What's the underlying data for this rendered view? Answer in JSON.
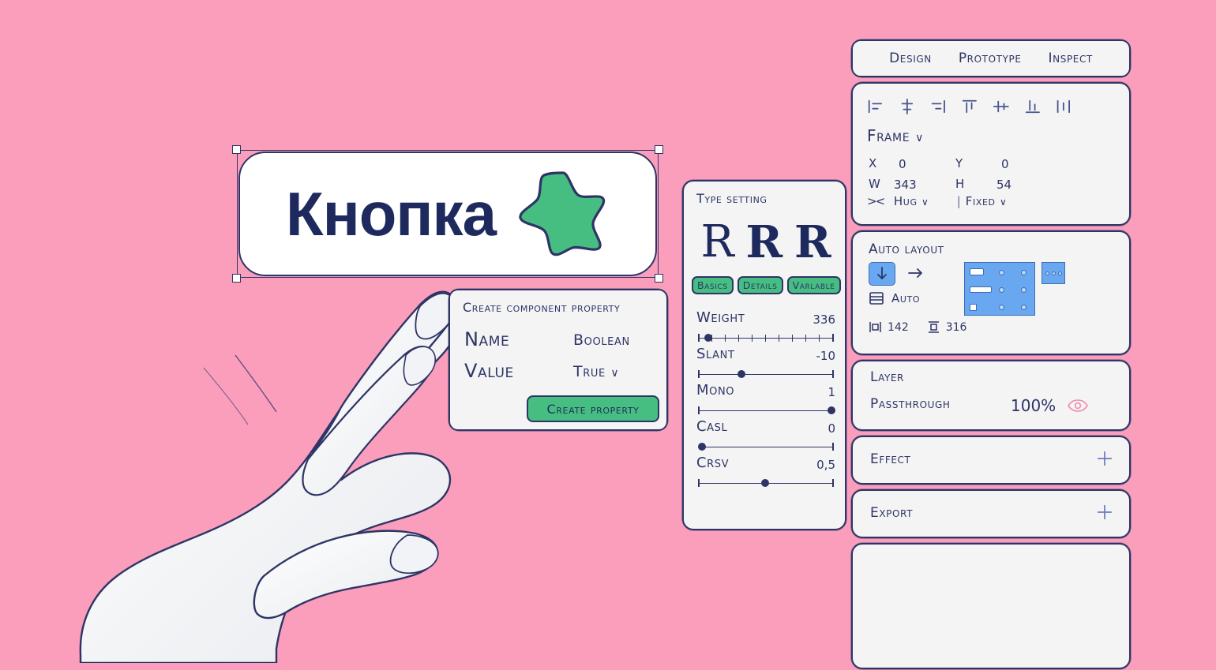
{
  "theme": {
    "background": "#FA9EBC",
    "ink": "#2E3566",
    "panel": "#F4F4F4",
    "green": "#46BE82",
    "blue": "#69A8F0",
    "button_text": "#1E2A5E"
  },
  "canvas": {
    "button_label": "Кнопка",
    "star_icon": "star-icon",
    "selected": true
  },
  "create_property_dialog": {
    "title": "Create component property",
    "rows": [
      {
        "key": "Name",
        "value": "Boolean",
        "has_chevron": false
      },
      {
        "key": "Value",
        "value": "True",
        "has_chevron": true,
        "chevron": "∨"
      }
    ],
    "submit_label": "Create property"
  },
  "type_setting": {
    "title": "Type setting",
    "specimen": [
      "R",
      "R",
      "R"
    ],
    "tabs": [
      "Basics",
      "Details",
      "Varlable"
    ],
    "active_tab": "Basics",
    "sliders": [
      {
        "name": "Weight",
        "value": "336",
        "pos": 8,
        "ticks": true
      },
      {
        "name": "Slant",
        "value": "-10",
        "pos": 30,
        "ticks": false
      },
      {
        "name": "Mono",
        "value": "1",
        "pos": 99,
        "ticks": false
      },
      {
        "name": "Casl",
        "value": "0",
        "pos": 1,
        "ticks": false
      },
      {
        "name": "Crsv",
        "value": "0,5",
        "pos": 48,
        "ticks": false
      }
    ]
  },
  "sidebar": {
    "tabs": [
      "Design",
      "Prototype",
      "Inspect"
    ],
    "active_tab": "Design",
    "properties": {
      "align_icons": [
        "align-left-icon",
        "align-horizontal-center-icon",
        "align-right-icon",
        "align-top-icon",
        "align-vertical-center-icon",
        "align-bottom-icon",
        "distribute-horizontal-icon"
      ],
      "node_type": "Frame",
      "node_type_chevron": "∨",
      "fields": [
        {
          "key": "X",
          "value": "0"
        },
        {
          "key": "Y",
          "value": "0"
        },
        {
          "key": "W",
          "value": "343"
        },
        {
          "key": "H",
          "value": "54"
        }
      ],
      "resize_icon": "resize-horizontal-icon",
      "width_sizing": "Hug",
      "width_chevron": "∨",
      "height_sizing": "Fixed",
      "height_chevron": "∨"
    },
    "auto_layout": {
      "title": "Auto layout",
      "direction_vertical_icon": "arrow-down-icon",
      "direction_horizontal_icon": "arrow-right-icon",
      "spacing_icon": "spacing-icon",
      "spacing_value": "Auto",
      "padding_horizontal_icon": "padding-horizontal-icon",
      "padding_horizontal": "142",
      "padding_vertical_icon": "padding-vertical-icon",
      "padding_vertical": "316",
      "alignment_grid_icon": "alignment-grid-icon",
      "more_options_icon": "more-options-icon"
    },
    "layer": {
      "title": "Layer",
      "blend_mode": "Passthrough",
      "opacity": "100%",
      "visibility_icon": "eye-icon"
    },
    "effect": {
      "title": "Effect",
      "add_icon": "plus-icon"
    },
    "export": {
      "title": "Export",
      "add_icon": "plus-icon"
    }
  }
}
